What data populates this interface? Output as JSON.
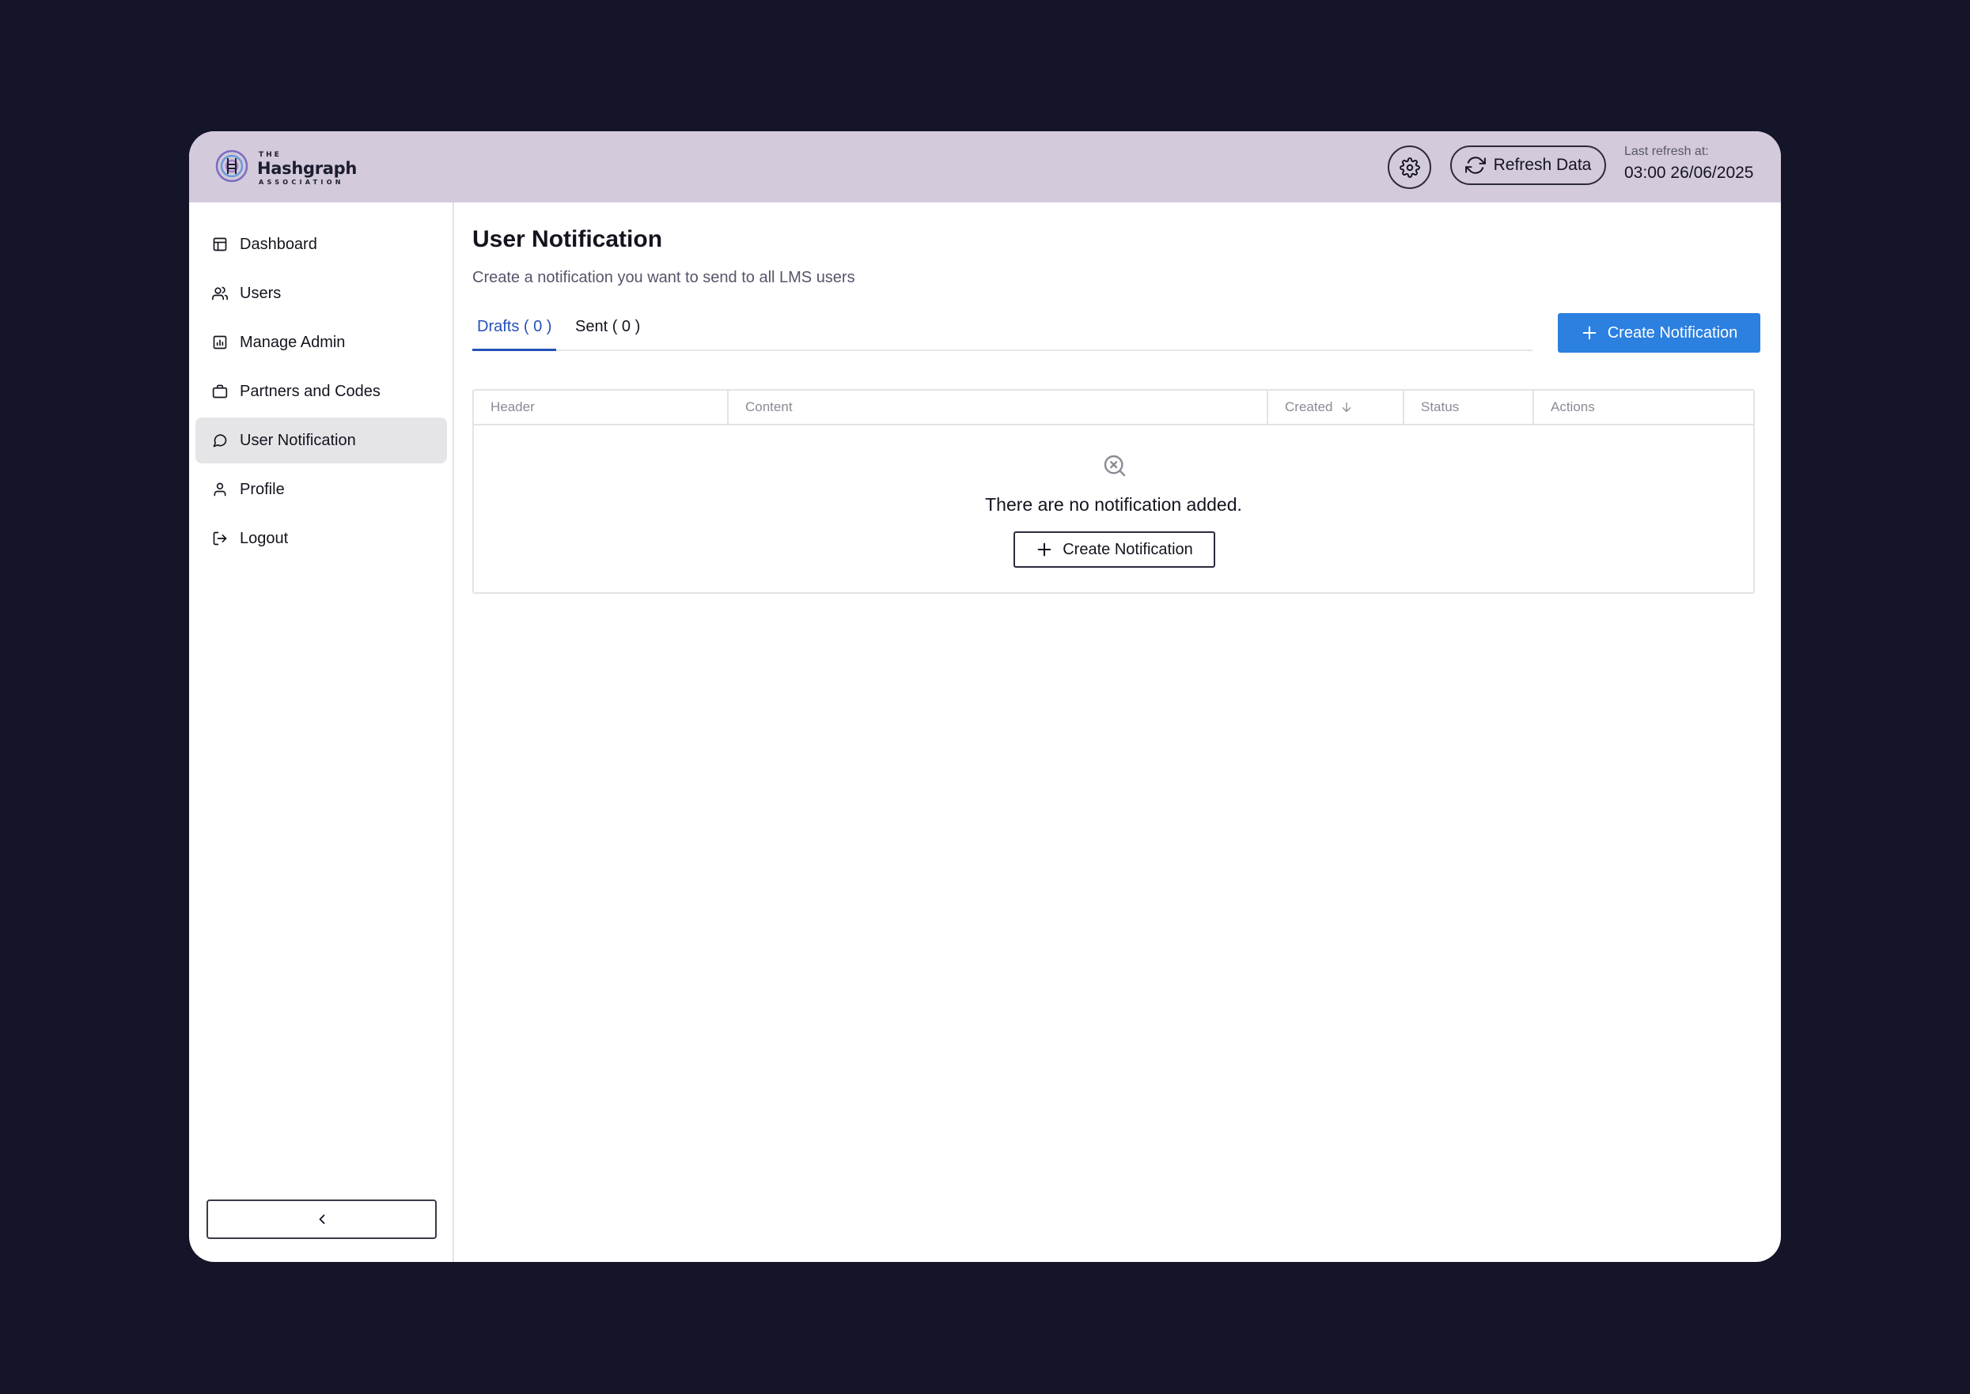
{
  "app": {
    "logo": {
      "line1": "THE",
      "line2": "Hashgraph",
      "line3": "ASSOCIATION"
    },
    "refresh_button": "Refresh Data",
    "last_refresh_label": "Last refresh at:",
    "last_refresh_value": "03:00 26/06/2025"
  },
  "sidebar": {
    "items": [
      {
        "label": "Dashboard",
        "icon": "layout-icon",
        "active": false
      },
      {
        "label": "Users",
        "icon": "users-icon",
        "active": false
      },
      {
        "label": "Manage Admin",
        "icon": "chart-icon",
        "active": false
      },
      {
        "label": "Partners and Codes",
        "icon": "briefcase-icon",
        "active": false
      },
      {
        "label": "User Notification",
        "icon": "message-icon",
        "active": true
      },
      {
        "label": "Profile",
        "icon": "user-icon",
        "active": false
      },
      {
        "label": "Logout",
        "icon": "logout-icon",
        "active": false
      }
    ],
    "collapse_icon": "chevron-left-icon"
  },
  "main": {
    "title": "User Notification",
    "subtitle": "Create a notification you want to send to all LMS users",
    "tabs": [
      {
        "label": "Drafts ( 0 )",
        "active": true
      },
      {
        "label": "Sent ( 0 )",
        "active": false
      }
    ],
    "create_button": "Create Notification",
    "table": {
      "columns": [
        "Header",
        "Content",
        "Created",
        "Status",
        "Actions"
      ],
      "sorted_column": "Created",
      "empty_text": "There are no notification added.",
      "empty_button": "Create Notification"
    }
  },
  "colors": {
    "background": "#141529",
    "topbar": "#d3cadb",
    "accent": "#2b80e0",
    "tab_active": "#2451b8"
  }
}
